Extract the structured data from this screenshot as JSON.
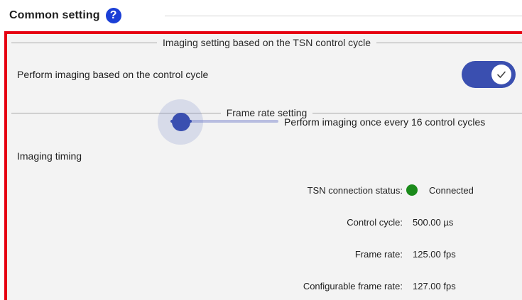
{
  "group": {
    "title": "Common setting",
    "help_glyph": "?"
  },
  "imaging_section": {
    "caption": "Imaging setting based on the TSN control cycle",
    "toggle_label": "Perform imaging based on the control cycle",
    "toggle_on": true
  },
  "frame_rate_section": {
    "caption": "Frame rate setting",
    "timing_label": "Imaging timing",
    "timing_value": "Perform imaging once every 16 control cycles"
  },
  "info": {
    "tsn_status_key": "TSN connection status:",
    "tsn_status_value": "Connected",
    "tsn_status_color": "#1a8a1a",
    "control_cycle_key": "Control cycle:",
    "control_cycle_value": "500.00 µs",
    "frame_rate_key": "Frame rate:",
    "frame_rate_value": "125.00 fps",
    "configurable_key": "Configurable frame rate:",
    "configurable_value": "127.00 fps"
  },
  "colors": {
    "accent": "#3a4fb0",
    "highlight_border": "#e60012",
    "help_icon": "#1b3fd6"
  }
}
